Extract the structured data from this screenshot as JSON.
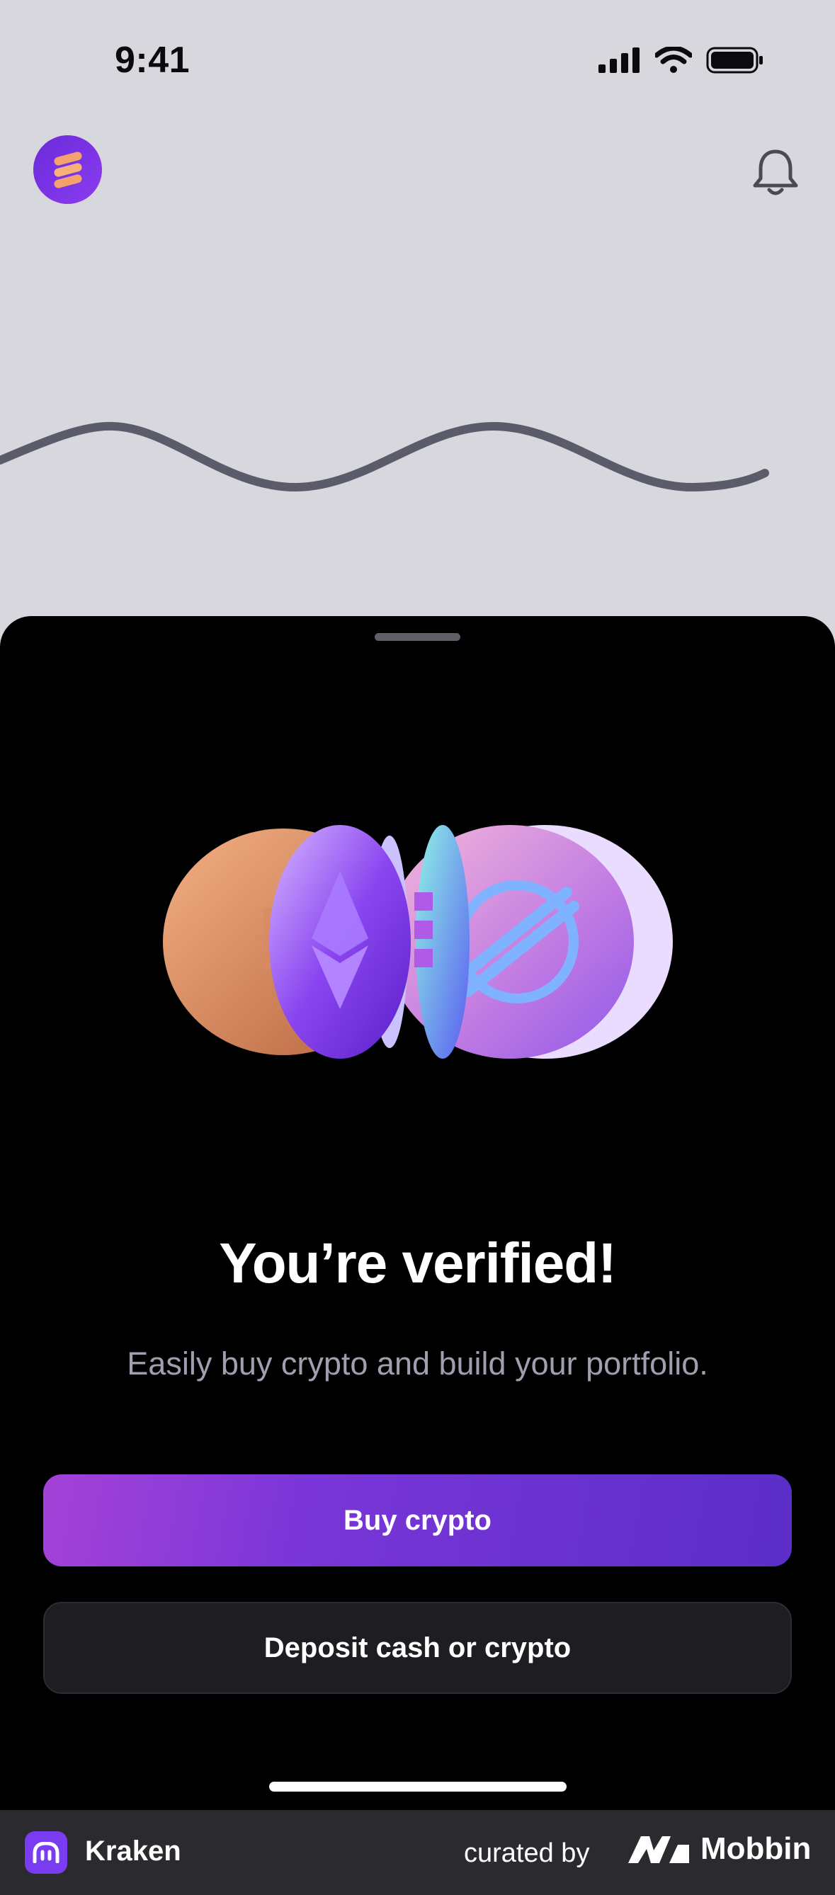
{
  "status_bar": {
    "time": "9:41"
  },
  "header": {
    "avatar_icon": "stack-icon",
    "notification_icon": "bell-icon"
  },
  "sheet": {
    "title": "You’re verified!",
    "subtitle": "Easily buy crypto and build your portfolio.",
    "primary_button": "Buy crypto",
    "secondary_button": "Deposit cash or crypto"
  },
  "footer": {
    "app_name": "Kraken",
    "curated_by": "curated by",
    "brand": "Mobbin"
  },
  "colors": {
    "accent": "#7a36d8",
    "background": "#d8d7dd",
    "sheet": "#000000"
  }
}
